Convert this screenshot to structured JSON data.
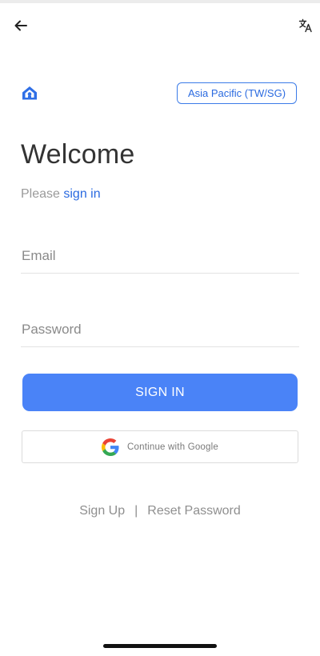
{
  "header": {
    "back_icon": "arrow-left-icon",
    "translate_icon": "translate-icon"
  },
  "brand": {
    "logo_icon": "house-logo-icon",
    "accent_color": "#2a6ae0"
  },
  "region": {
    "label": "Asia Pacific (TW/SG)"
  },
  "welcome": {
    "title": "Welcome",
    "prompt": "Please",
    "prompt_link": "sign in"
  },
  "form": {
    "email_placeholder": "Email",
    "email_value": "",
    "password_placeholder": "Password",
    "password_value": ""
  },
  "actions": {
    "signin_label": "SIGN IN",
    "signin_color": "#4a83f7",
    "google_label": "Continue with Google",
    "google_icon": "google-g-icon"
  },
  "footer": {
    "signup_label": "Sign Up",
    "separator": "|",
    "reset_label": "Reset Password"
  }
}
